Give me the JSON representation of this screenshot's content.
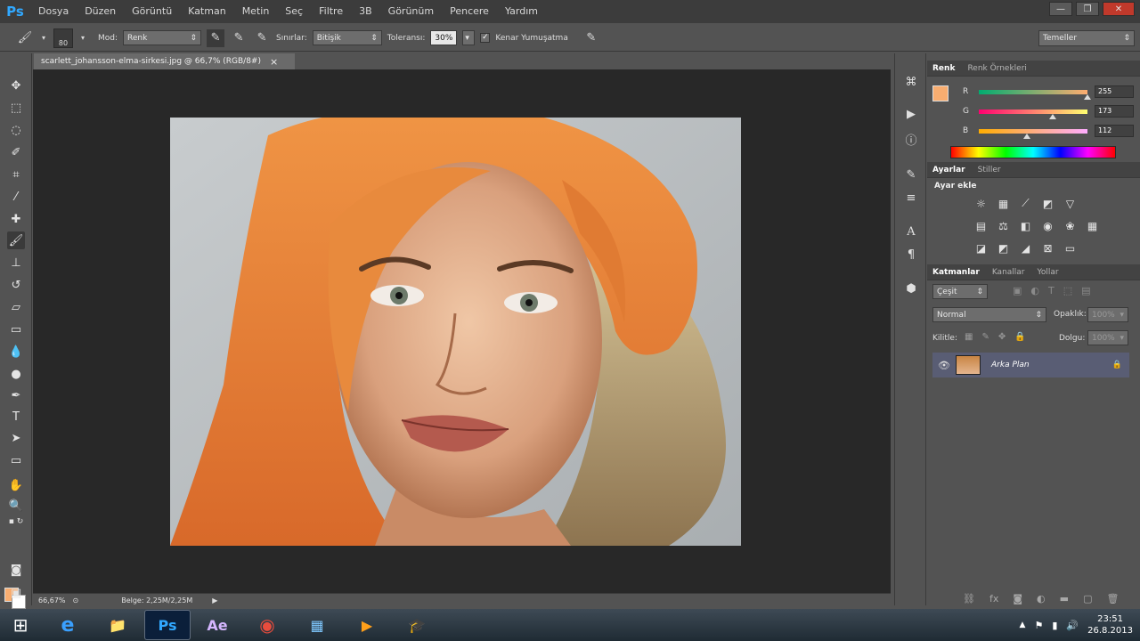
{
  "app": {
    "logo": "Ps",
    "menu": [
      "Dosya",
      "Düzen",
      "Görüntü",
      "Katman",
      "Metin",
      "Seç",
      "Filtre",
      "3B",
      "Görünüm",
      "Pencere",
      "Yardım"
    ],
    "window_controls": [
      "—",
      "❐",
      "✕"
    ]
  },
  "options_bar": {
    "brush_size": "80",
    "mode_label": "Mod:",
    "mode_value": "Renk",
    "limits_label": "Sınırlar:",
    "limits_value": "Bitişik",
    "tolerance_label": "Toleransı:",
    "tolerance_value": "30%",
    "antialias_label": "Kenar Yumuşatma",
    "antialias_checked": true,
    "workspace": "Temeller"
  },
  "document": {
    "tab_title": "scarlett_johansson-elma-sirkesi.jpg @ 66,7% (RGB/8#)",
    "tab_close": "×",
    "zoom": "66,67%",
    "doc_info": "Belge: 2,25M/2,25M"
  },
  "color_panel": {
    "tabs": [
      "Renk",
      "Renk Örnekleri"
    ],
    "foreground": "#f8ad70",
    "channels": [
      {
        "name": "R",
        "value": "255",
        "level": 255,
        "gradient_start": "#00ad70",
        "gradient_end": "#ffad70"
      },
      {
        "name": "G",
        "value": "173",
        "level": 173,
        "gradient_start": "#ff0070",
        "gradient_end": "#ffff70"
      },
      {
        "name": "B",
        "value": "112",
        "level": 112,
        "gradient_start": "#ffad00",
        "gradient_end": "#ffadff"
      }
    ]
  },
  "adjustments_panel": {
    "tabs": [
      "Ayarlar",
      "Stiller"
    ],
    "title": "Ayar ekle"
  },
  "layers_panel": {
    "tabs": [
      "Katmanlar",
      "Kanallar",
      "Yollar"
    ],
    "filter_kind": "Çeşit",
    "blend_mode": "Normal",
    "opacity_label": "Opaklık:",
    "opacity_value": "100%",
    "lock_label": "Kilitle:",
    "fill_label": "Dolgu:",
    "fill_value": "100%",
    "layers": [
      {
        "name": "Arka Plan",
        "visible": true,
        "locked": true
      }
    ]
  },
  "taskbar": {
    "apps": [
      "e",
      "📁",
      "Ps",
      "Ae",
      "◉",
      "▦",
      "▶",
      "🎓"
    ],
    "time": "23:51",
    "date": "26.8.2013"
  }
}
